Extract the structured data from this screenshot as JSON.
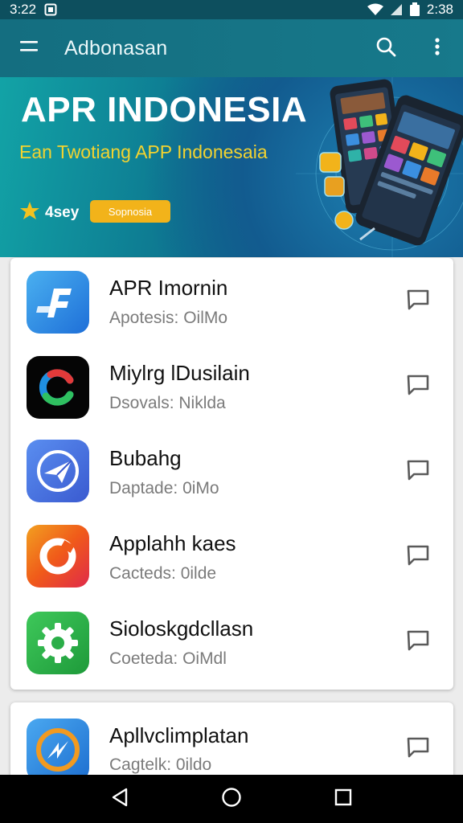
{
  "status_bar": {
    "time_left": "3:22",
    "time_right": "2:38"
  },
  "app_bar": {
    "title": "Adbonasan"
  },
  "banner": {
    "title": "APR INDONESIA",
    "subtitle": "Ean Twotiang APP Indonesaia",
    "rating_label": "4sey",
    "badge_label": "Sopnosia"
  },
  "apps": [
    {
      "name": "APR Imornin",
      "meta": "Apotesis: OilMo",
      "icon": "blue-f-app-icon",
      "color": "#2f8fe0"
    },
    {
      "name": "Miylrg lDusilain",
      "meta": "Dsovals: Niklda",
      "icon": "c-logo-app-icon",
      "color": "#000000"
    },
    {
      "name": "Bubahg",
      "meta": "Daptade: 0iMo",
      "icon": "paper-plane-app-icon",
      "color": "#4a6ee0"
    },
    {
      "name": "Applahh kaes",
      "meta": "Cacteds: 0ilde",
      "icon": "orange-ring-app-icon",
      "color": "#f05a1a"
    },
    {
      "name": "Sioloskgdcllasn",
      "meta": "Coeteda: OiMdl",
      "icon": "gear-app-icon",
      "color": "#2fb24a"
    },
    {
      "name": "Apllvclimplatan",
      "meta": "Cagtelk: 0ildo",
      "icon": "compass-app-icon",
      "color": "#2a7fd4"
    }
  ]
}
